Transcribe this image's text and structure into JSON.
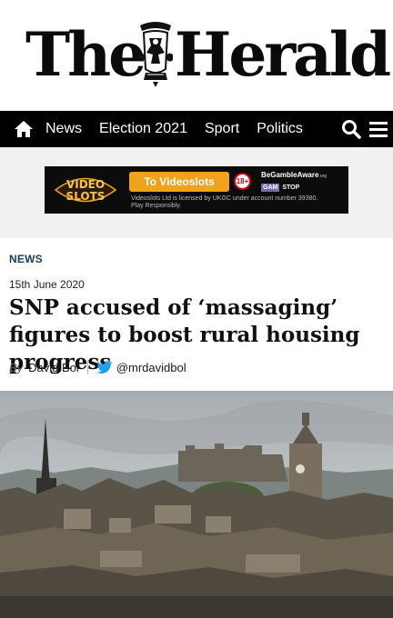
{
  "masthead": {
    "logo_left": "The",
    "logo_right": "Herald",
    "crest_name": "herald-crest"
  },
  "nav": {
    "home_icon": "home-icon",
    "items": [
      "News",
      "Election 2021",
      "Sport",
      "Politics"
    ],
    "search_icon": "search-icon",
    "menu_icon": "hamburger-menu-icon",
    "bar_color": "#000000"
  },
  "ad": {
    "logo_text": "VIDEO SLOTS",
    "button_label": "To Videoslots",
    "age_badge": "18+",
    "bga_text": "BeGambleAware",
    "bga_suffix": ".org",
    "gam_label": "GAM",
    "stop_label": "STOP",
    "small_print": "Videoslots Ltd is licensed by UKGC under account number 39380. Play Responsibly.",
    "accent_color": "#f0a21c"
  },
  "article": {
    "section": "NEWS",
    "date": "15th June 2020",
    "headline": "SNP accused of ‘massaging’ figures to boost rural housing progress",
    "by_prefix": "By",
    "author": "David Bol",
    "twitter_handle": "@mrdavidbol",
    "twitter_icon": "twitter-bird-icon",
    "hero_image": "edinburgh-skyline-photo"
  }
}
